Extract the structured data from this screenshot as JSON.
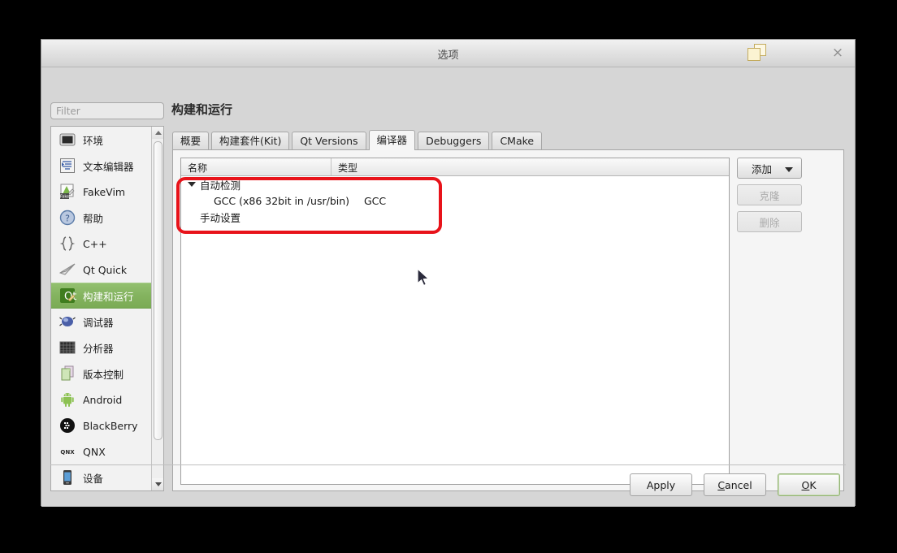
{
  "window": {
    "title": "选项",
    "close_label": "×",
    "icon": "window-restore-icon"
  },
  "search": {
    "placeholder": "Filter",
    "value": ""
  },
  "page": {
    "title": "构建和运行"
  },
  "sidebar": {
    "items": [
      {
        "label": "环境",
        "icon": "monitor-icon",
        "selected": false
      },
      {
        "label": "文本编辑器",
        "icon": "text-editor-icon",
        "selected": false
      },
      {
        "label": "FakeVim",
        "icon": "fakevim-icon",
        "selected": false
      },
      {
        "label": "帮助",
        "icon": "help-question-icon",
        "selected": false
      },
      {
        "label": "C++",
        "icon": "braces-icon",
        "selected": false
      },
      {
        "label": "Qt Quick",
        "icon": "paper-plane-icon",
        "selected": false
      },
      {
        "label": "构建和运行",
        "icon": "qt-build-run-icon",
        "selected": true
      },
      {
        "label": "调试器",
        "icon": "bug-icon",
        "selected": false
      },
      {
        "label": "分析器",
        "icon": "analyzer-grid-icon",
        "selected": false
      },
      {
        "label": "版本控制",
        "icon": "documents-icon",
        "selected": false
      },
      {
        "label": "Android",
        "icon": "android-robot-icon",
        "selected": false
      },
      {
        "label": "BlackBerry",
        "icon": "blackberry-icon",
        "selected": false
      },
      {
        "label": "QNX",
        "icon": "qnx-icon",
        "selected": false
      },
      {
        "label": "设备",
        "icon": "phone-device-icon",
        "selected": false
      }
    ],
    "scrollbar": {
      "up_arrow": "scroll-up-icon",
      "down_arrow": "scroll-down-icon"
    }
  },
  "tabs": [
    {
      "label": "概要",
      "active": false
    },
    {
      "label": "构建套件(Kit)",
      "active": false
    },
    {
      "label": "Qt Versions",
      "active": false
    },
    {
      "label": "编译器",
      "active": true
    },
    {
      "label": "Debuggers",
      "active": false
    },
    {
      "label": "CMake",
      "active": false
    }
  ],
  "compilers_table": {
    "columns": [
      "名称",
      "类型"
    ],
    "rows": [
      {
        "name": "自动检测",
        "type": "",
        "level": "group",
        "expanded": true
      },
      {
        "name": "GCC (x86 32bit in /usr/bin)",
        "type": "GCC",
        "level": "child",
        "expanded": false
      },
      {
        "name": "手动设置",
        "type": "",
        "level": "group2",
        "expanded": false
      }
    ]
  },
  "side_buttons": {
    "add": {
      "label": "添加",
      "enabled": true,
      "has_dropdown": true
    },
    "clone": {
      "label": "克隆",
      "enabled": false,
      "has_dropdown": false
    },
    "delete": {
      "label": "删除",
      "enabled": false,
      "has_dropdown": false
    }
  },
  "dialog_buttons": {
    "apply": {
      "label": "Apply",
      "mnemonic": ""
    },
    "cancel": {
      "label": "Cancel",
      "mnemonic": "C"
    },
    "ok": {
      "label": "OK",
      "mnemonic": "O",
      "default": true
    }
  },
  "annotation": {
    "type": "red-rounded-rectangle",
    "color": "#e8131a",
    "targets": "compilers-table-rows"
  },
  "colors": {
    "selection_green": "#84b35f",
    "dialog_bg": "#d6d6d6",
    "panel_bg": "#f5f5f5",
    "annotation_red": "#e8131a"
  }
}
